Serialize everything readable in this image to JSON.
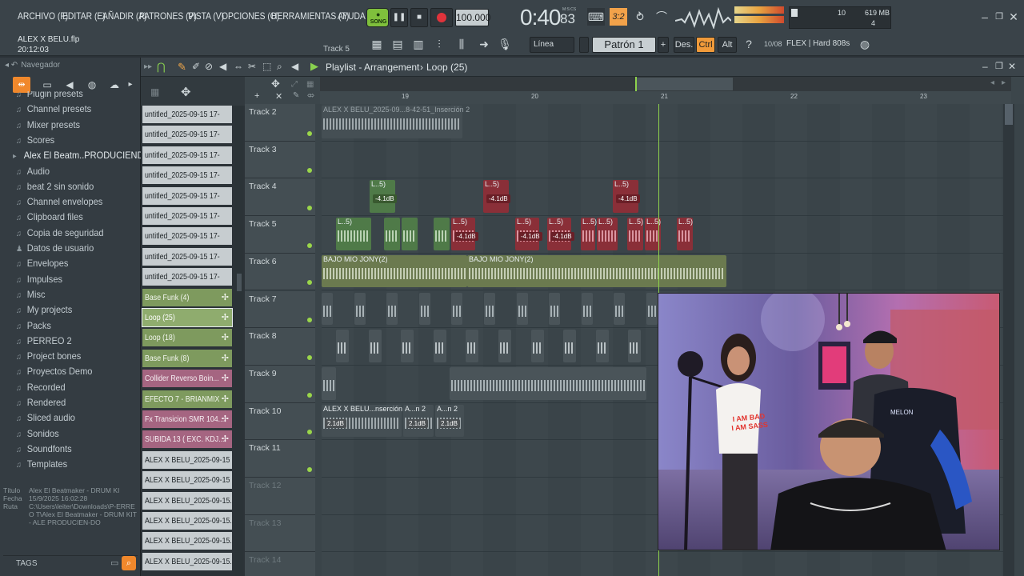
{
  "menu": [
    "ARCHIVO (F)",
    "EDITAR (E)",
    "AÑADIR (A)",
    "PATRONES (P)",
    "VISTA (V)",
    "OPCIONES (O)",
    "HERRAMIENTAS (T)",
    "AYUDA"
  ],
  "project": {
    "file": "ALEX X BELU.flp",
    "time": "20:12:03",
    "track_hint": "Track 5"
  },
  "transport": {
    "mode": "SONG",
    "tempo": "100.000",
    "position": "0:40",
    "position_frac": "83",
    "counter_label": "M:S:CS",
    "snap": "Línea",
    "pattern": "Patrón 1",
    "cpu": "619 MB",
    "cpu_val": "10",
    "poly": "4"
  },
  "toolbar_right": {
    "des": "Des.",
    "ctrl": "Ctrl",
    "alt": "Alt",
    "hint": "10/08",
    "plugin": "FLEX | Hard 808s"
  },
  "browser": {
    "title": "Navegador",
    "items": [
      "Plugin presets",
      "Channel presets",
      "Mixer presets",
      "Scores",
      "Alex El Beatm..PRODUCIENDO",
      "Audio",
      "beat 2 sin sonido",
      "Channel envelopes",
      "Clipboard files",
      "Copia de seguridad",
      "Datos de usuario",
      "Envelopes",
      "Impulses",
      "Misc",
      "My projects",
      "Packs",
      "PERREO 2",
      "Project bones",
      "Proyectos Demo",
      "Recorded",
      "Rendered",
      "Sliced audio",
      "Sonidos",
      "Soundfonts",
      "Templates"
    ],
    "info": {
      "titulo_label": "Título",
      "titulo": "Alex El Beatmaker - DRUM KI",
      "fecha_label": "Fecha",
      "fecha": "15/9/2025 16:02:28",
      "ruta_label": "Ruta",
      "ruta": "C:\\Users\\leiter\\Downloads\\P-ERREO T\\Alex El Beatmaker - DRUM KIT - ALE PRODUCIEN-DO"
    },
    "tags": "TAGS"
  },
  "picker": [
    {
      "label": "untitled_2025-09-15 17-",
      "color": "#c7cdd0",
      "text": "#1d2326"
    },
    {
      "label": "untitled_2025-09-15 17-",
      "color": "#c7cdd0",
      "text": "#1d2326"
    },
    {
      "label": "untitled_2025-09-15 17-",
      "color": "#c7cdd0",
      "text": "#1d2326"
    },
    {
      "label": "untitled_2025-09-15 17-",
      "color": "#c7cdd0",
      "text": "#1d2326"
    },
    {
      "label": "untitled_2025-09-15 17-",
      "color": "#c7cdd0",
      "text": "#1d2326"
    },
    {
      "label": "untitled_2025-09-15 17-",
      "color": "#c7cdd0",
      "text": "#1d2326"
    },
    {
      "label": "untitled_2025-09-15 17-",
      "color": "#c7cdd0",
      "text": "#1d2326"
    },
    {
      "label": "untitled_2025-09-15 17-",
      "color": "#c7cdd0",
      "text": "#1d2326"
    },
    {
      "label": "untitled_2025-09-15 17-",
      "color": "#c7cdd0",
      "text": "#1d2326"
    },
    {
      "label": "Base Funk (4)",
      "color": "#7e9a5e",
      "text": "#f2f6ee"
    },
    {
      "label": "Loop (25)",
      "color": "#7e9a5e",
      "text": "#ffffff"
    },
    {
      "label": "Loop (18)",
      "color": "#7e9a5e",
      "text": "#f2f6ee"
    },
    {
      "label": "Base Funk (8)",
      "color": "#7e9a5e",
      "text": "#f2f6ee"
    },
    {
      "label": "Collider Reverso Boin...",
      "color": "#a56581",
      "text": "#f6eef2"
    },
    {
      "label": "EFECTO 7 - BRIANMIX",
      "color": "#7e9a5e",
      "text": "#f2f6ee"
    },
    {
      "label": "Fx Transicion SMR 104...",
      "color": "#a56581",
      "text": "#f6eef2"
    },
    {
      "label": "SUBIDA 13 ( EXC. KDJ...",
      "color": "#a56581",
      "text": "#f6eef2"
    },
    {
      "label": "ALEX X BELU_2025-09-15",
      "color": "#c7cdd0",
      "text": "#1d2326"
    },
    {
      "label": "ALEX X BELU_2025-09-15",
      "color": "#c7cdd0",
      "text": "#1d2326"
    },
    {
      "label": "ALEX X BELU_2025-09-15.",
      "color": "#c7cdd0",
      "text": "#1d2326"
    },
    {
      "label": "ALEX X BELU_2025-09-15.",
      "color": "#c7cdd0",
      "text": "#1d2326"
    },
    {
      "label": "ALEX X BELU_2025-09-15.",
      "color": "#c7cdd0",
      "text": "#1d2326"
    },
    {
      "label": "ALEX X BELU_2025-09-15.",
      "color": "#c7cdd0",
      "text": "#1d2326"
    }
  ],
  "playlist": {
    "title": "Playlist - Arrangement",
    "pattern": "Loop (25)",
    "bars": [
      "19",
      "20",
      "21",
      "22",
      "23"
    ],
    "tracks": [
      "Track 2",
      "Track 3",
      "Track 4",
      "Track 5",
      "Track 6",
      "Track 7",
      "Track 8",
      "Track 9",
      "Track 10",
      "Track 11",
      "Track 12",
      "Track 13",
      "Track 14"
    ],
    "clip_labels": {
      "t2": "ALEX X BELU_2025-09...8-42-51_Inserción 2",
      "loop": "L..5)",
      "db": "-4.1dB",
      "bajo": "BAJO MIO JONY(2)",
      "t10a": "ALEX X BELU...nserción 2",
      "t10b": "A...n 2",
      "t10db": "2.1dB"
    }
  },
  "webcam": {
    "sign1": "I AM BAD",
    "sign2": "I AM SASS",
    "chair": "MELON"
  }
}
